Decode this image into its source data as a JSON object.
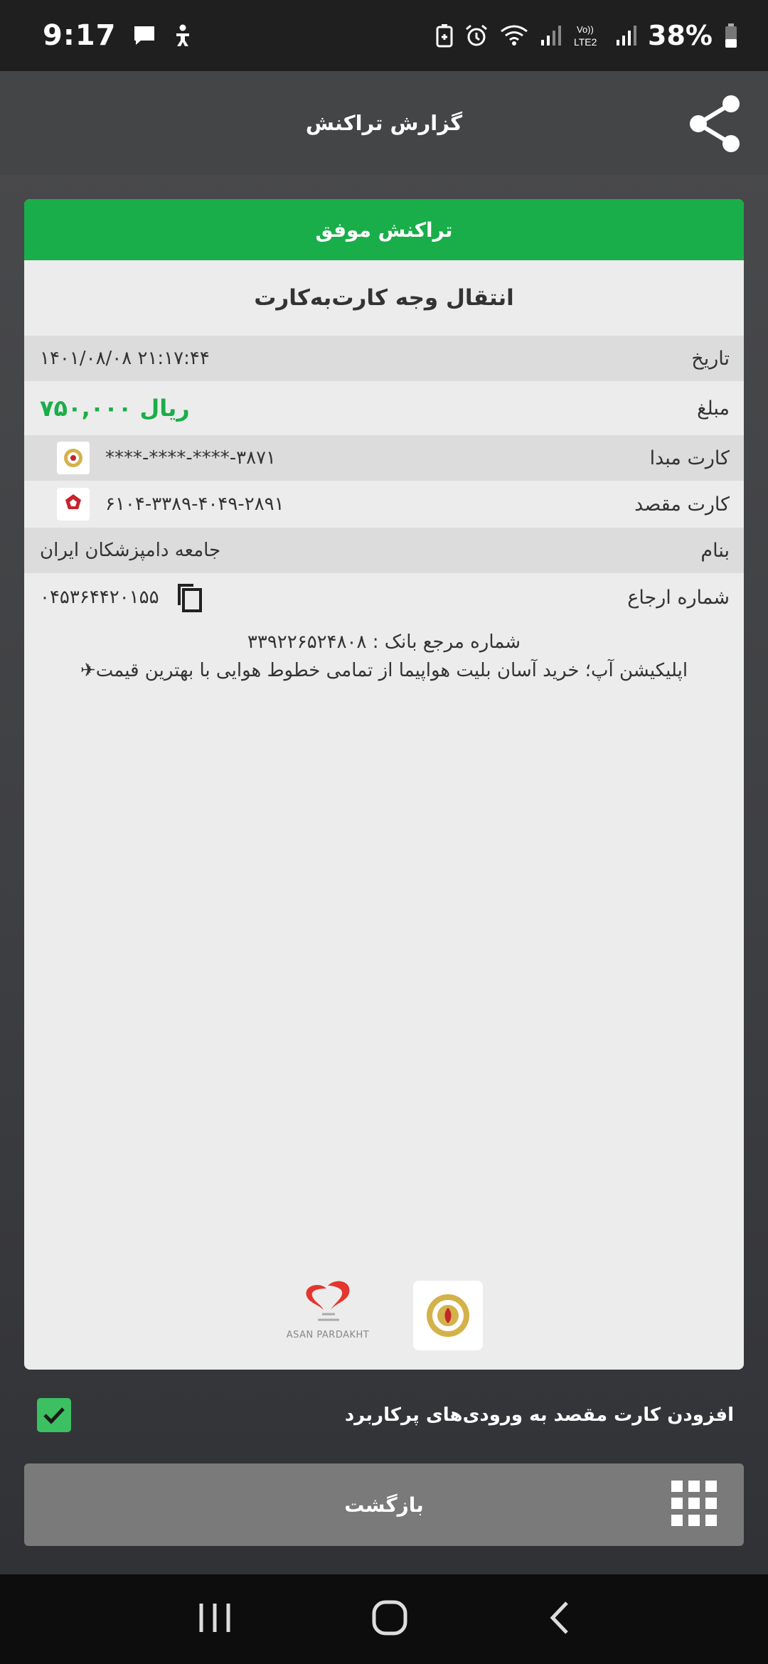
{
  "status_bar": {
    "time": "9:17",
    "battery": "38%",
    "icons": [
      "message-icon",
      "accessibility-icon",
      "battery-saver-icon",
      "alarm-icon",
      "wifi-icon",
      "signal-icon",
      "volte-lte2-icon",
      "signal-icon",
      "battery-icon"
    ]
  },
  "app_bar": {
    "title": "گزارش تراکنش",
    "share_icon": "share-icon"
  },
  "receipt": {
    "status": "تراکنش موفق",
    "transaction_type": "انتقال وجه کارت‌به‌کارت",
    "rows": {
      "date": {
        "label": "تاریخ",
        "value": "۱۴۰۱/۰۸/۰۸ ۲۱:۱۷:۴۴"
      },
      "amount": {
        "label": "مبلغ",
        "value": "۷۵۰,۰۰۰ ریال"
      },
      "source_card": {
        "label": "کارت مبدا",
        "value": "****-****-****-۳۸۷۱"
      },
      "dest_card": {
        "label": "کارت مقصد",
        "value": "۶۱۰۴-۳۳۸۹-۴۰۴۹-۲۸۹۱"
      },
      "name": {
        "label": "بنام",
        "value": "جامعه دامپزشکان ایران"
      },
      "reference": {
        "label": "شماره ارجاع",
        "value": "۰۴۵۳۶۴۴۲۰۱۵۵"
      }
    },
    "bank_reference": "شماره مرجع بانک : ۳۳۹۲۲۶۵۲۴۸۰۸",
    "promo": "اپلیکیشن آپ؛ خرید آسان بلیت هواپیما از تمامی خطوط هوایی با بهترین قیمت✈",
    "asan_logo_text": "ASAN PARDAKHT"
  },
  "save_card": {
    "label": "افزودن کارت مقصد به ورودی‌های پرکاربرد",
    "checked": true
  },
  "back_button": {
    "label": "بازگشت"
  },
  "colors": {
    "success": "#19ae49",
    "checkbox": "#3cc062",
    "app_bar": "#444547"
  }
}
